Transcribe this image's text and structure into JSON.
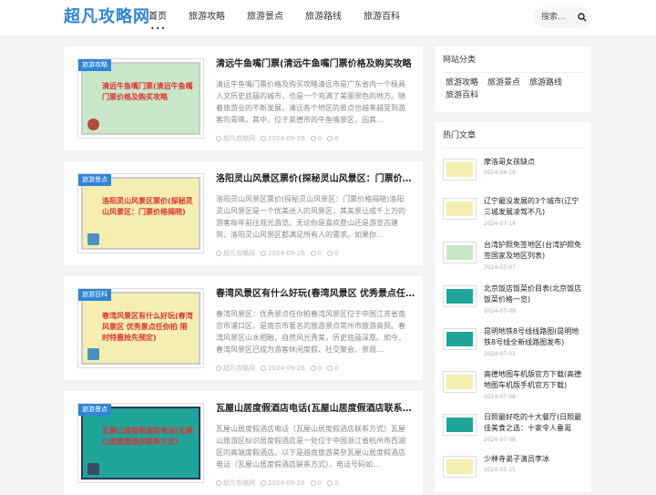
{
  "site": {
    "logo": "超凡攻略网"
  },
  "nav": [
    "首页",
    "旅游攻略",
    "旅游景点",
    "旅游路线",
    "旅游百科"
  ],
  "nav_active_dots": "•••",
  "search": {
    "placeholder": "搜索..."
  },
  "articles": [
    {
      "tag": "旅游攻略",
      "thumb_text": "清远牛鱼嘴门票(清远牛鱼嘴门票价格及购买攻略",
      "thumb_bg": "#c9e8c8",
      "badge_color": "#b34a3f",
      "title": "清远牛鱼嘴门票(清远牛鱼嘴门票价格及购买攻略",
      "excerpt": "清远牛鱼嘴门票价格及购买攻略清远市是广东省内一个极具人文历史底蕴的城市，也是一个充满了美丽景色的地方。随着旅游业的不断发展，清远各个地区的景点也越来越受到游客的青睐。其中，位于英德市的牛鱼嘴景区，因其...",
      "author": "超凡攻略网",
      "date": "2024-09-26",
      "views": "0",
      "comments": "0"
    },
    {
      "tag": "旅游景点",
      "thumb_text": "洛阳灵山风景区票价(探秘灵山风景区：门票价格揭晓)",
      "thumb_bg": "#f4eeb0",
      "badge_color": "#4a90c8",
      "title": "洛阳灵山风景区票价(探秘灵山风景区：门票价格揭晓)",
      "excerpt": "洛阳灵山风景区票价(探秘灵山风景区：门票价格揭晓)洛阳灵山风景区是一个优美迷人的风景区，其美景让成千上万的游客每年前往观光游览。无论你是喜欢登山还是游览古建筑，洛阳灵山风景区都满足所有人的需求。如果你...",
      "author": "超凡攻略网",
      "date": "2024-09-26",
      "views": "0",
      "comments": "0"
    },
    {
      "tag": "旅游百科",
      "thumb_text": "春湾风景区有什么好玩(春湾风景区 优秀景点任你拍 限时特惠抢先预定)",
      "thumb_bg": "#f4eeb0",
      "badge_color": "#4a90c8",
      "title": "春湾风景区有什么好玩(春湾风景区 优秀景点任你拍 限时特惠抢先预定)",
      "excerpt": "春湾风景区：优秀景点任你拍春湾风景区位于中国江苏省南京市浦口区，是南京市著名的旅游景点常州市旅游商贸。春湾风景区山水相融，自然风光秀美，历史底蕴深厚。如今，春湾风景区已成为游客休闲度假、社交聚会、景观...",
      "author": "超凡攻略网",
      "date": "2024-09-26",
      "views": "0",
      "comments": "0"
    },
    {
      "tag": "旅游景点",
      "thumb_text": "瓦屋山居度假酒店电话(瓦屋山居度假酒店联系方式)",
      "thumb_bg": "#20a59a",
      "badge_color": "#3a4a6a",
      "title": "瓦屋山居度假酒店电话(瓦屋山居度假酒店联系方式)",
      "excerpt": "瓦屋山居度假酒店电话（瓦屋山居度假酒店联系方式）瓦屋山旅游区标识居度假酒店是一处位于中国浙江省杭州市西湖区的高端度假酒店。以下是越南旅游美奈瓦屋山居度假酒店电话（瓦屋山居度假酒店联系方式）。电话号码如...",
      "author": "超凡攻略网",
      "date": "2024-09-26",
      "views": "0",
      "comments": "0"
    }
  ],
  "sidebar": {
    "categories_title": "网站分类",
    "categories": [
      "旅游攻略",
      "旅游景点",
      "旅游路线",
      "旅游百科"
    ],
    "hot_title": "热门文章",
    "hot": [
      {
        "title": "摩洛哥女孩缺点",
        "date": "2024-06-19",
        "color": "#f4eeb0"
      },
      {
        "title": "辽宁最没发展的3个城市(辽宁三城发展凌驾不凡)",
        "date": "2024-07-14",
        "color": "#f4eeb0"
      },
      {
        "title": "台湾护照免签地区(台湾护照免签国家及地区列表)",
        "date": "2024-07-07",
        "color": "#c9e8c8"
      },
      {
        "title": "北京饭店饭菜价目表(北京饭店饭菜价格一览)",
        "date": "2024-07-09",
        "color": "#20a59a"
      },
      {
        "title": "昆明地铁8号线线路图(昆明地铁8号线全新线路图发布)",
        "date": "2024-07-01",
        "color": "#20a59a"
      },
      {
        "title": "高德地图车机版官方下载(高德地图车机版手机官方下载)",
        "date": "2024-07-08",
        "color": "#f4eeb0"
      },
      {
        "title": "日照最好吃的十大餐厅(日照最佳美食之选：十家令人垂涎",
        "date": "2024-07-08",
        "color": "#20a59a"
      },
      {
        "title": "少林寺弟子演员李冰",
        "date": "2024-05-15",
        "color": "#f4eeb0"
      }
    ]
  }
}
